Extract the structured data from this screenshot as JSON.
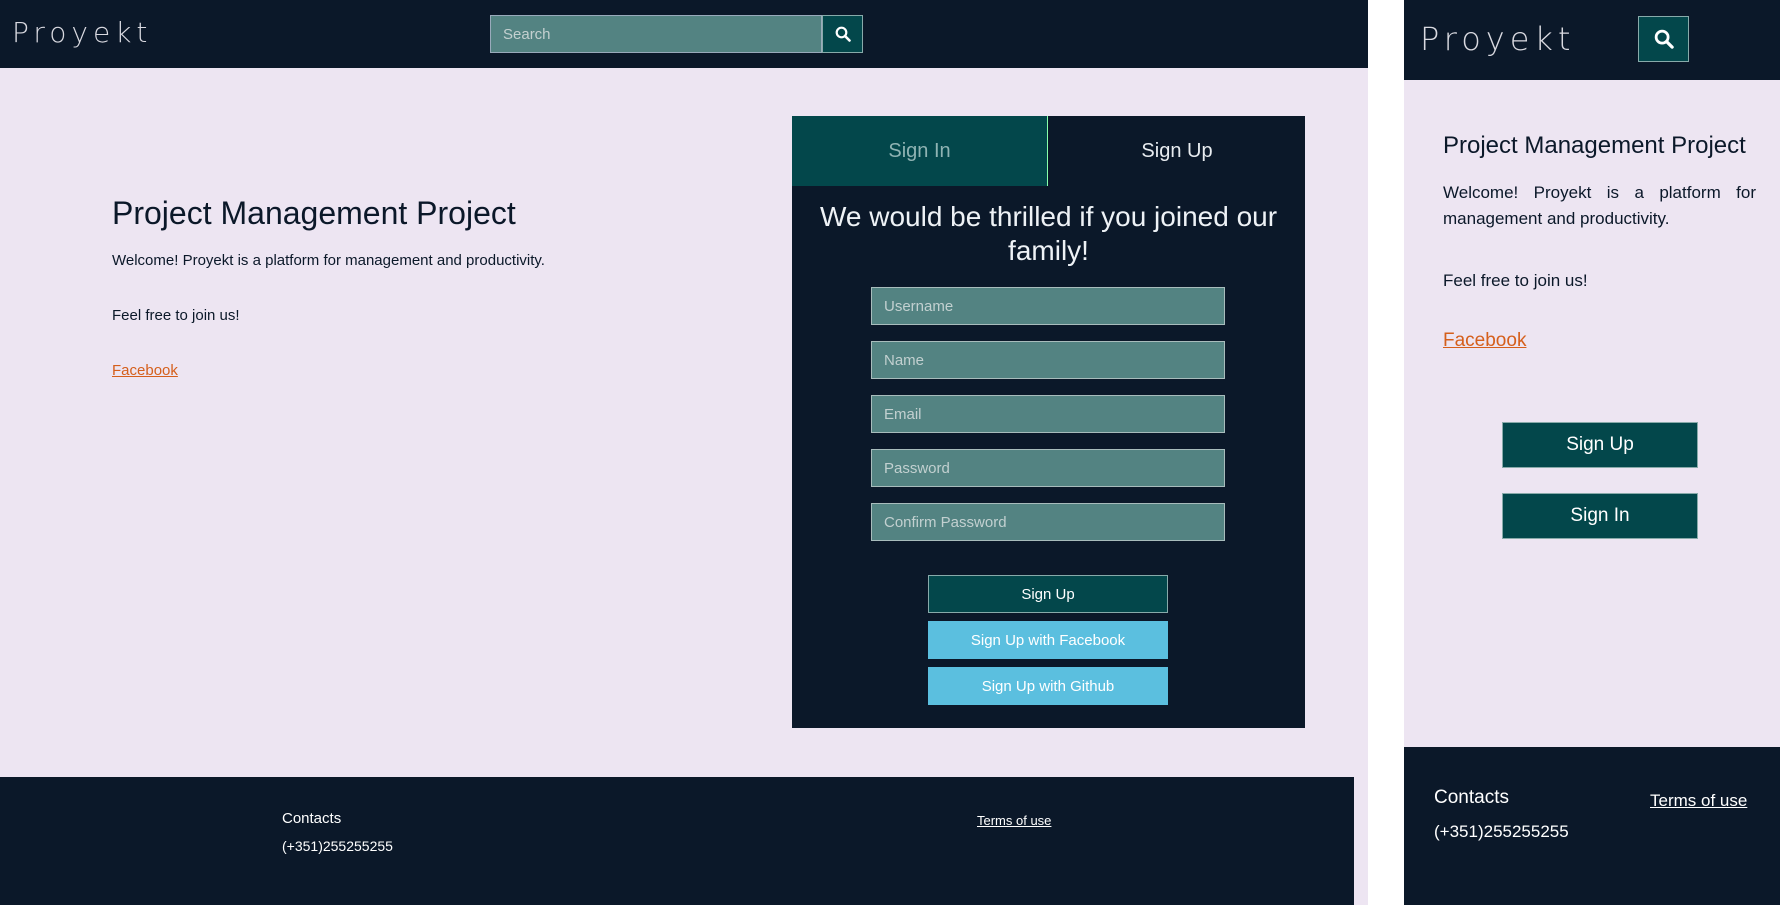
{
  "brand": {
    "name": "Proyekt"
  },
  "header": {
    "search_placeholder": "Search",
    "search_icon": "magnifier"
  },
  "intro": {
    "title": "Project Management Project",
    "welcome": "Welcome! Proyekt is a platform for management and productivity.",
    "invite": "Feel free to join us!",
    "facebook_link": "Facebook"
  },
  "auth": {
    "tabs": [
      {
        "label": "Sign In",
        "active": false
      },
      {
        "label": "Sign Up",
        "active": true
      }
    ],
    "heading": "We would be thrilled if you joined our family!",
    "fields": [
      {
        "placeholder": "Username"
      },
      {
        "placeholder": "Name"
      },
      {
        "placeholder": "Email"
      },
      {
        "placeholder": "Password"
      },
      {
        "placeholder": "Confirm Password"
      }
    ],
    "submit_label": "Sign Up",
    "facebook_label": "Sign Up with Facebook",
    "github_label": "Sign Up with Github"
  },
  "mobile": {
    "signup_label": "Sign Up",
    "signin_label": "Sign In"
  },
  "footer": {
    "contacts_title": "Contacts",
    "phone": "(+351)255255255",
    "terms": "Terms of use"
  },
  "colors": {
    "dark_navy": "#0b1829",
    "teal_dark": "#03474b",
    "teal_field": "#538382",
    "social_blue": "#5bbfdf",
    "background": "#ede5f2",
    "link_orange": "#d55f1c"
  }
}
